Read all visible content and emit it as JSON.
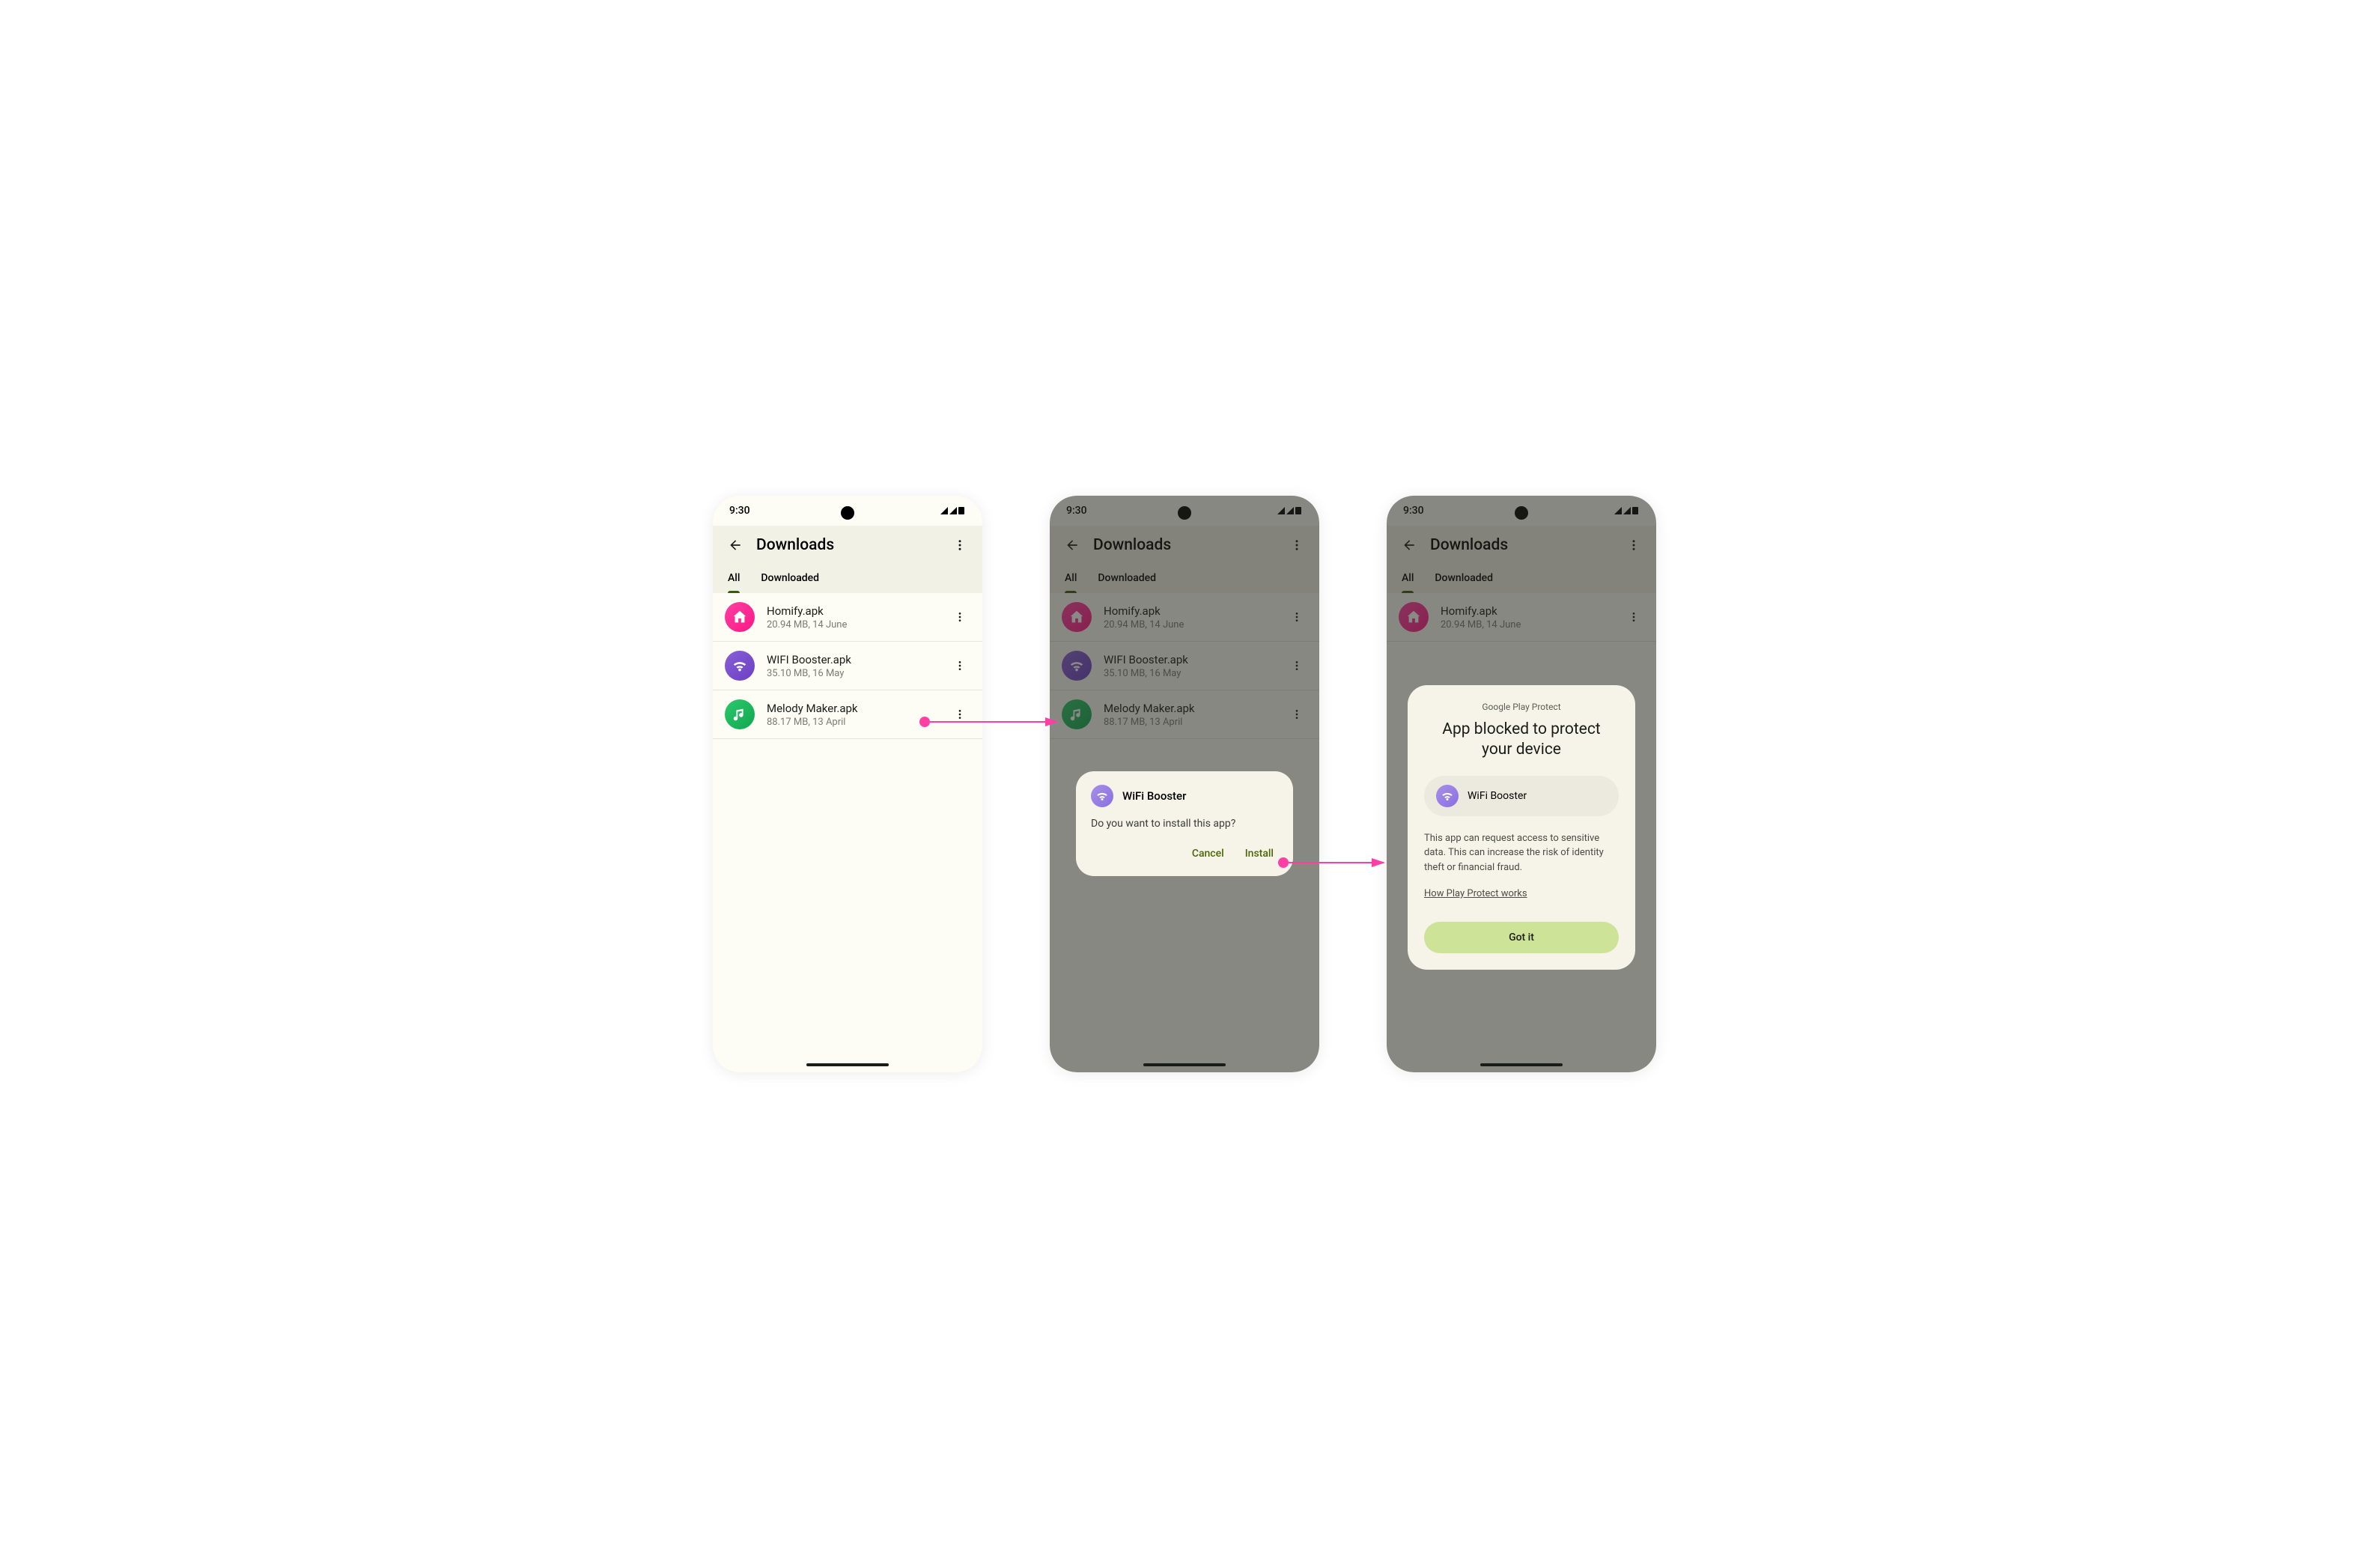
{
  "status": {
    "time": "9:30"
  },
  "header": {
    "title": "Downloads",
    "tabs": {
      "all": "All",
      "downloaded": "Downloaded"
    }
  },
  "downloads": [
    {
      "name": "Homify.apk",
      "meta": "20.94 MB, 14 June"
    },
    {
      "name": "WIFI Booster.apk",
      "meta": "35.10 MB, 16 May"
    },
    {
      "name": "Melody Maker.apk",
      "meta": "88.17 MB, 13 April"
    }
  ],
  "install_dialog": {
    "app_name": "WiFi Booster",
    "question": "Do you want to install this app?",
    "cancel": "Cancel",
    "install": "Install"
  },
  "block_dialog": {
    "eyebrow": "Google Play Protect",
    "title": "App blocked to protect your device",
    "app_name": "WiFi Booster",
    "body": "This app can request access to sensitive data. This can increase the risk of identity theft or financial fraud.",
    "link": "How Play Protect works",
    "primary": "Got it"
  }
}
